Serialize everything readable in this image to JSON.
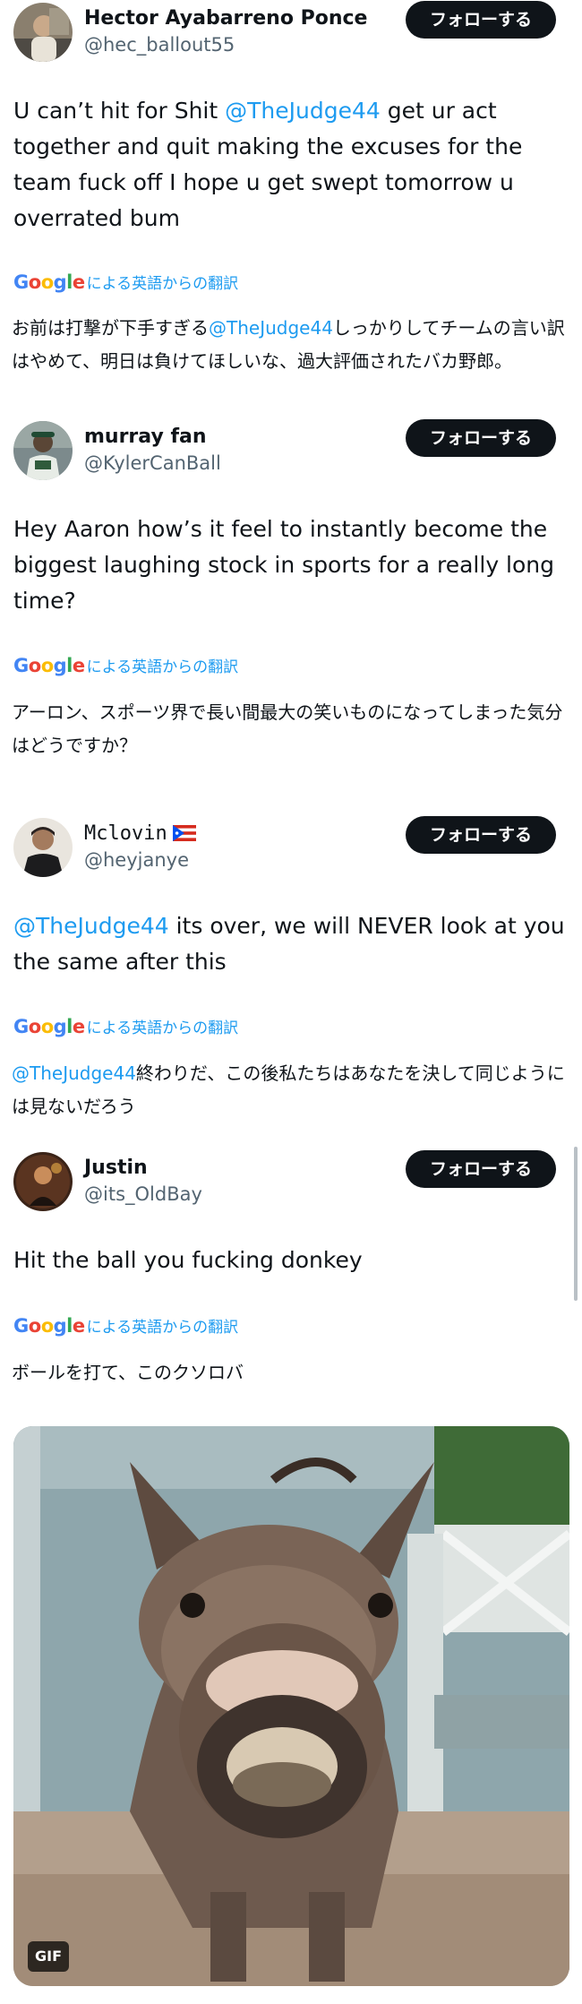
{
  "follow_label": "フォローする",
  "google_logo": [
    "G",
    "o",
    "o",
    "g",
    "l",
    "e"
  ],
  "google_colors": [
    "#4285F4",
    "#EA4335",
    "#FBBC05",
    "#4285F4",
    "#34A853",
    "#EA4335"
  ],
  "translate_suffix": "による英語からの翻訳",
  "posts": [
    {
      "name": "Hector Ayabarreno Ponce",
      "handle": "@hec_ballout55",
      "text_before": "U can’t hit for Shit ",
      "mention": "@TheJudge44",
      "text_after": " get ur act together and quit making the excuses for the team fuck off I hope u get swept tomorrow u overrated bum",
      "translation_before": "お前は打撃が下手すぎる",
      "translation_mention": "@TheJudge44",
      "translation_after": "しっかりしてチームの言い訳はやめて、明日は負けてほしいな、過大評価されたバカ野郎。"
    },
    {
      "name": "murray fan",
      "handle": "@KylerCanBall",
      "text": "Hey Aaron how’s it feel to instantly become the biggest laughing stock in sports for a really long time?",
      "translation": "アーロン、スポーツ界で長い間最大の笑いものになってしまった気分はどうですか？"
    },
    {
      "name": "Mclovin",
      "flag": "puerto-rico-flag-icon",
      "handle": "@heyjanye",
      "mention": "@TheJudge44",
      "text_after": " its over, we will NEVER look at you the same after this",
      "translation_mention": "@TheJudge44",
      "translation_after": "終わりだ、この後私たちはあなたを決して同じようには見ないだろう"
    },
    {
      "name": "Justin",
      "handle": "@its_OldBay",
      "text": "Hit the ball you fucking donkey",
      "translation": "ボールを打て、このクソロバ"
    }
  ],
  "media": {
    "badge": "GIF",
    "icon": "donkey-gif"
  }
}
